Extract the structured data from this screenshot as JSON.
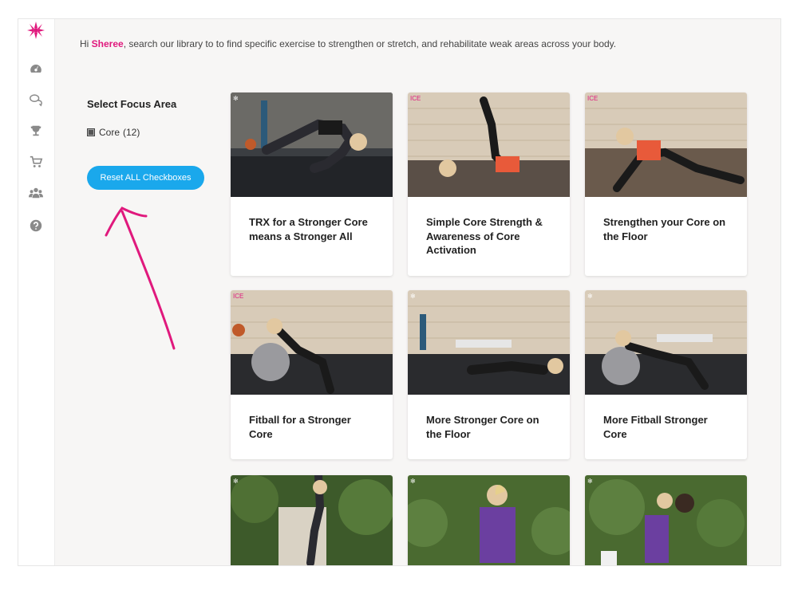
{
  "app": {
    "brand_color": "#e0197d",
    "accent_color": "#1aa8ec"
  },
  "sidebar": {
    "items": [
      {
        "name": "dashboard-icon"
      },
      {
        "name": "chat-icon"
      },
      {
        "name": "trophy-icon"
      },
      {
        "name": "cart-icon"
      },
      {
        "name": "community-icon"
      },
      {
        "name": "help-icon"
      }
    ]
  },
  "greeting": {
    "prefix": "Hi ",
    "name": "Sheree",
    "suffix": ", search our library to to find specific exercise to strengthen or stretch, and rehabilitate weak areas across your body."
  },
  "filters": {
    "title": "Select Focus Area",
    "options": [
      {
        "label": "Core",
        "count": "(12)"
      }
    ],
    "reset_label": "Reset ALL Checkboxes"
  },
  "cards": [
    {
      "title": "TRX for a Stronger Core means a Stronger All"
    },
    {
      "title": "Simple Core Strength & Awareness of Core Activation"
    },
    {
      "title": "Strengthen your Core on the Floor"
    },
    {
      "title": "Fitball for a Stronger Core"
    },
    {
      "title": "More Stronger Core on the Floor"
    },
    {
      "title": "More Fitball Stronger Core"
    },
    {
      "title": ""
    },
    {
      "title": ""
    },
    {
      "title": ""
    }
  ]
}
